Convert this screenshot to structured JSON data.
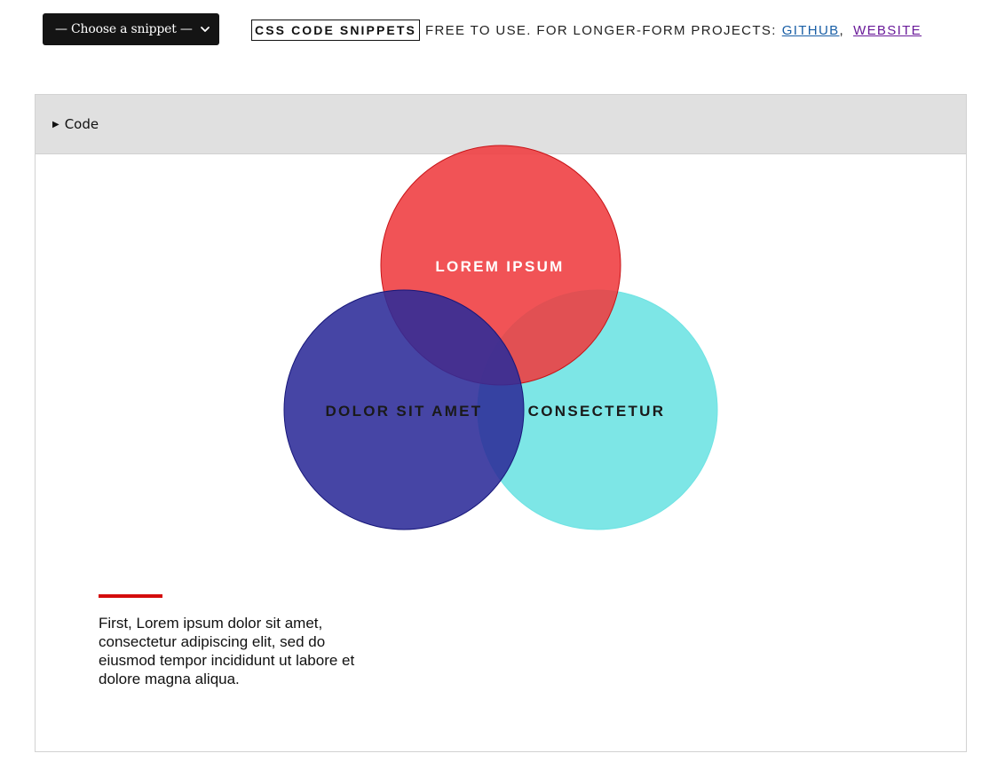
{
  "header": {
    "snippet_select": {
      "selected_label": "— Choose a snippet —"
    },
    "brand": "CSS CODE SNIPPETS",
    "tagline_text": "FREE TO USE. FOR LONGER-FORM PROJECTS:",
    "links": [
      {
        "label": "GITHUB"
      },
      {
        "label": "WEBSITE"
      }
    ],
    "separator": ","
  },
  "panel": {
    "summary_label": "Code"
  },
  "venn": {
    "circles": [
      {
        "label": "LOREM IPSUM",
        "color": "#ef3b3f",
        "label_color": "#ffffff"
      },
      {
        "label": "DOLOR SIT AMET",
        "color": "#2c2b98",
        "label_color": "#1a1a1a"
      },
      {
        "label": "CONSECTETUR",
        "color": "#6fe3e3",
        "label_color": "#1a1a1a"
      }
    ]
  },
  "caption": {
    "accent_color": "#d40c0c",
    "text": "First, Lorem ipsum dolor sit amet, consectetur adipiscing elit, sed do eiusmod tempor incididunt ut labore et dolore magna aliqua."
  }
}
